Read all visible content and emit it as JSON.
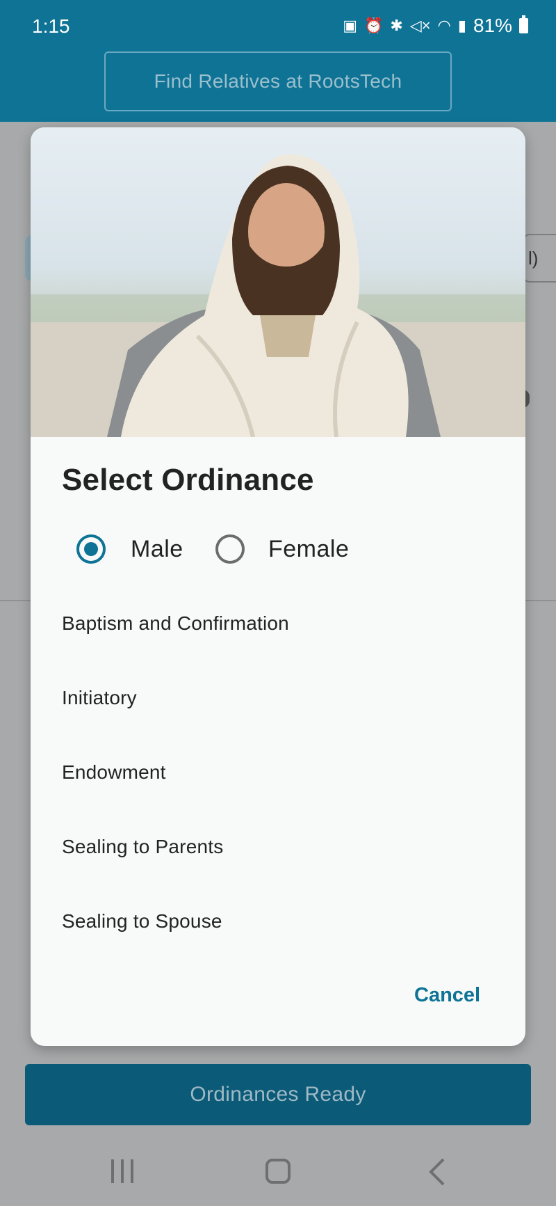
{
  "status_bar": {
    "time": "1:15",
    "battery": "81%",
    "icons": [
      "battery-saver-icon",
      "alarm-icon",
      "bluetooth-icon",
      "mute-icon",
      "wifi-icon",
      "signal-icon",
      "battery-icon"
    ]
  },
  "header": {
    "find_relatives_label": "Find Relatives at RootsTech"
  },
  "background": {
    "right_pill_fragment": "l)"
  },
  "dialog": {
    "title": "Select Ordinance",
    "gender_options": [
      {
        "label": "Male",
        "selected": true
      },
      {
        "label": "Female",
        "selected": false
      }
    ],
    "ordinances": [
      "Baptism and Confirmation",
      "Initiatory",
      "Endowment",
      "Sealing to Parents",
      "Sealing to Spouse"
    ],
    "cancel_label": "Cancel"
  },
  "footer": {
    "ordinances_ready_label": "Ordinances Ready"
  },
  "navbar": {
    "icons": [
      "recents-icon",
      "home-icon",
      "back-icon"
    ]
  },
  "colors": {
    "primary": "#0e7395",
    "dialog_bg": "#f8fafa",
    "scrim": "#a7a9aa",
    "dark_button": "#0a5a78"
  }
}
